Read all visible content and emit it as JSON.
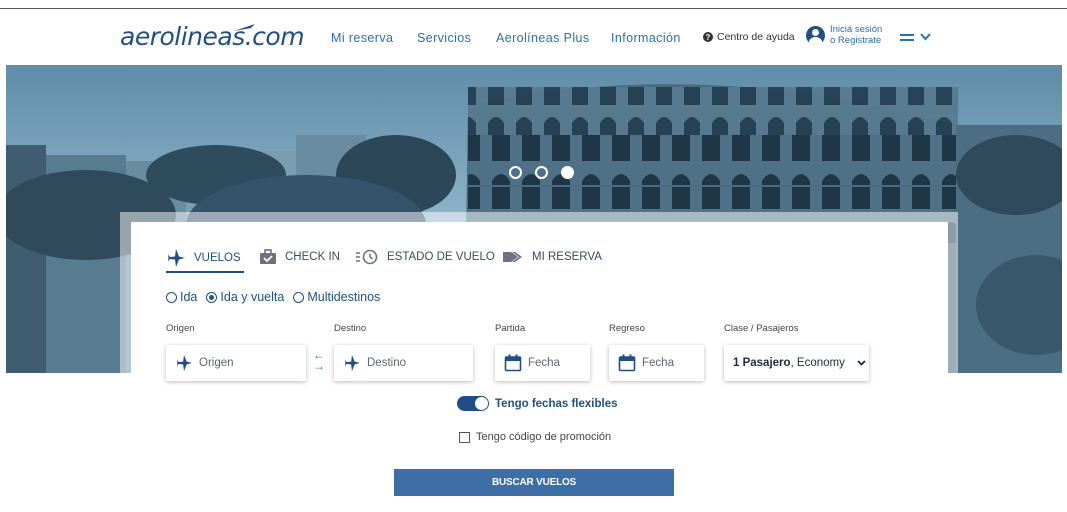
{
  "header": {
    "logo": "aerolineas.com",
    "nav": [
      "Mi reserva",
      "Servicios",
      "Aerolíneas Plus",
      "Información"
    ],
    "help": "Centro de ayuda",
    "login_line1": "Iniciá sesión",
    "login_line2": "o Registrate"
  },
  "hero": {
    "slides": 3,
    "active_slide": 3
  },
  "tabs": [
    "VUELOS",
    "CHECK IN",
    "ESTADO DE VUELO",
    "MI RESERVA"
  ],
  "trip_types": {
    "options": [
      "Ida",
      "Ida y vuelta",
      "Multidestinos"
    ],
    "selected": "Ida y vuelta"
  },
  "form": {
    "origin_label": "Origen",
    "origin_placeholder": "Origen",
    "dest_label": "Destino",
    "dest_placeholder": "Destino",
    "depart_label": "Partida",
    "depart_placeholder": "Fecha",
    "return_label": "Regreso",
    "return_placeholder": "Fecha",
    "class_label": "Clase / Pasajeros",
    "passengers": "1 Pasajero",
    "cabin": ", Economy"
  },
  "flexible_dates": "Tengo fechas flexibles",
  "promo_code": "Tengo código de promoción",
  "search_button": "BUSCAR VUELOS",
  "colors": {
    "brand": "#1f4f86",
    "link": "#2a6fb0",
    "button": "#3d6ea6"
  }
}
